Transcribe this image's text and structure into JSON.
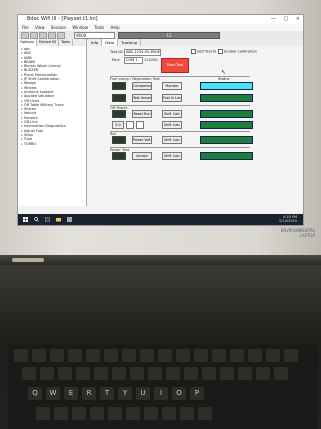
{
  "window": {
    "title": "Bdac Wifi III - [Playset.t1.ini]",
    "controls": "— □ ×"
  },
  "menu": [
    "File",
    "View",
    "Session",
    "Window",
    "Tools",
    "Help"
  ],
  "toolbar": {
    "field_value": "9600",
    "bar_value": "11"
  },
  "sidebar": {
    "tabs": [
      "Options",
      "Device ID",
      "Tools"
    ],
    "items": [
      "abc",
      "ABS",
      "AMB",
      "BRAKE",
      "Blinker Wiper Unimpl",
      "BUZZER",
      "Plural Manipulation",
      "JP Shift Combination",
      "Wedge",
      "Wheels",
      "Antenna Lookout",
      "Applied Valuation",
      "Off Lines",
      "Off Table Military Trace",
      "Shares",
      "Vehicle",
      "Sensors",
      "Off-Line",
      "Information Diagnostics",
      "Adjust Fuel",
      "Shop",
      "Tune",
      "TURBO"
    ]
  },
  "main": {
    "tabs": [
      "Info",
      "Data",
      "Tracking"
    ],
    "field1_label": "Text ID:",
    "field1_value": "ABC-1234 SO-PAGE 0",
    "field2_label": "Port:",
    "field2_value": "COM 1",
    "field2_suffix": "115200",
    "red_button": "Start Test",
    "check1": "Self Test III",
    "check2": "Enable Calibration",
    "group1": "Fuel pump / Regulation Test",
    "group2": "Off Power",
    "group3": "Ref.",
    "group4": "Power Test",
    "rows": [
      {
        "btn1": "Comparison",
        "btn2": "Monitor"
      },
      {
        "btn1": "Test Values",
        "btn2": "Fuel In Level"
      },
      {
        "btn1": "Reset Run",
        "btn2": "Shift Calc"
      },
      {
        "btn1": "0.0",
        "btn2": "Shift Calc"
      },
      {
        "btn1": "Power Voltage",
        "btn2": "Shift Calc"
      },
      {
        "btn1": "Accept",
        "btn2": "Shift Calc"
      }
    ],
    "right_top_label": "Status"
  },
  "taskbar": {
    "time": "4:18 PM",
    "date": "5/14/2019"
  },
  "brand": {
    "line1": "ENVIRONMENTAL",
    "line2": "LAPTOP"
  },
  "keyboard_row": [
    "Q",
    "W",
    "E",
    "R",
    "T",
    "Y",
    "U",
    "I",
    "O",
    "P"
  ],
  "colors": {
    "status_red": "#ee4b3c",
    "status_cyan": "#48e3ef",
    "status_green": "#1f7f3a",
    "taskbar": "#1d2230"
  }
}
